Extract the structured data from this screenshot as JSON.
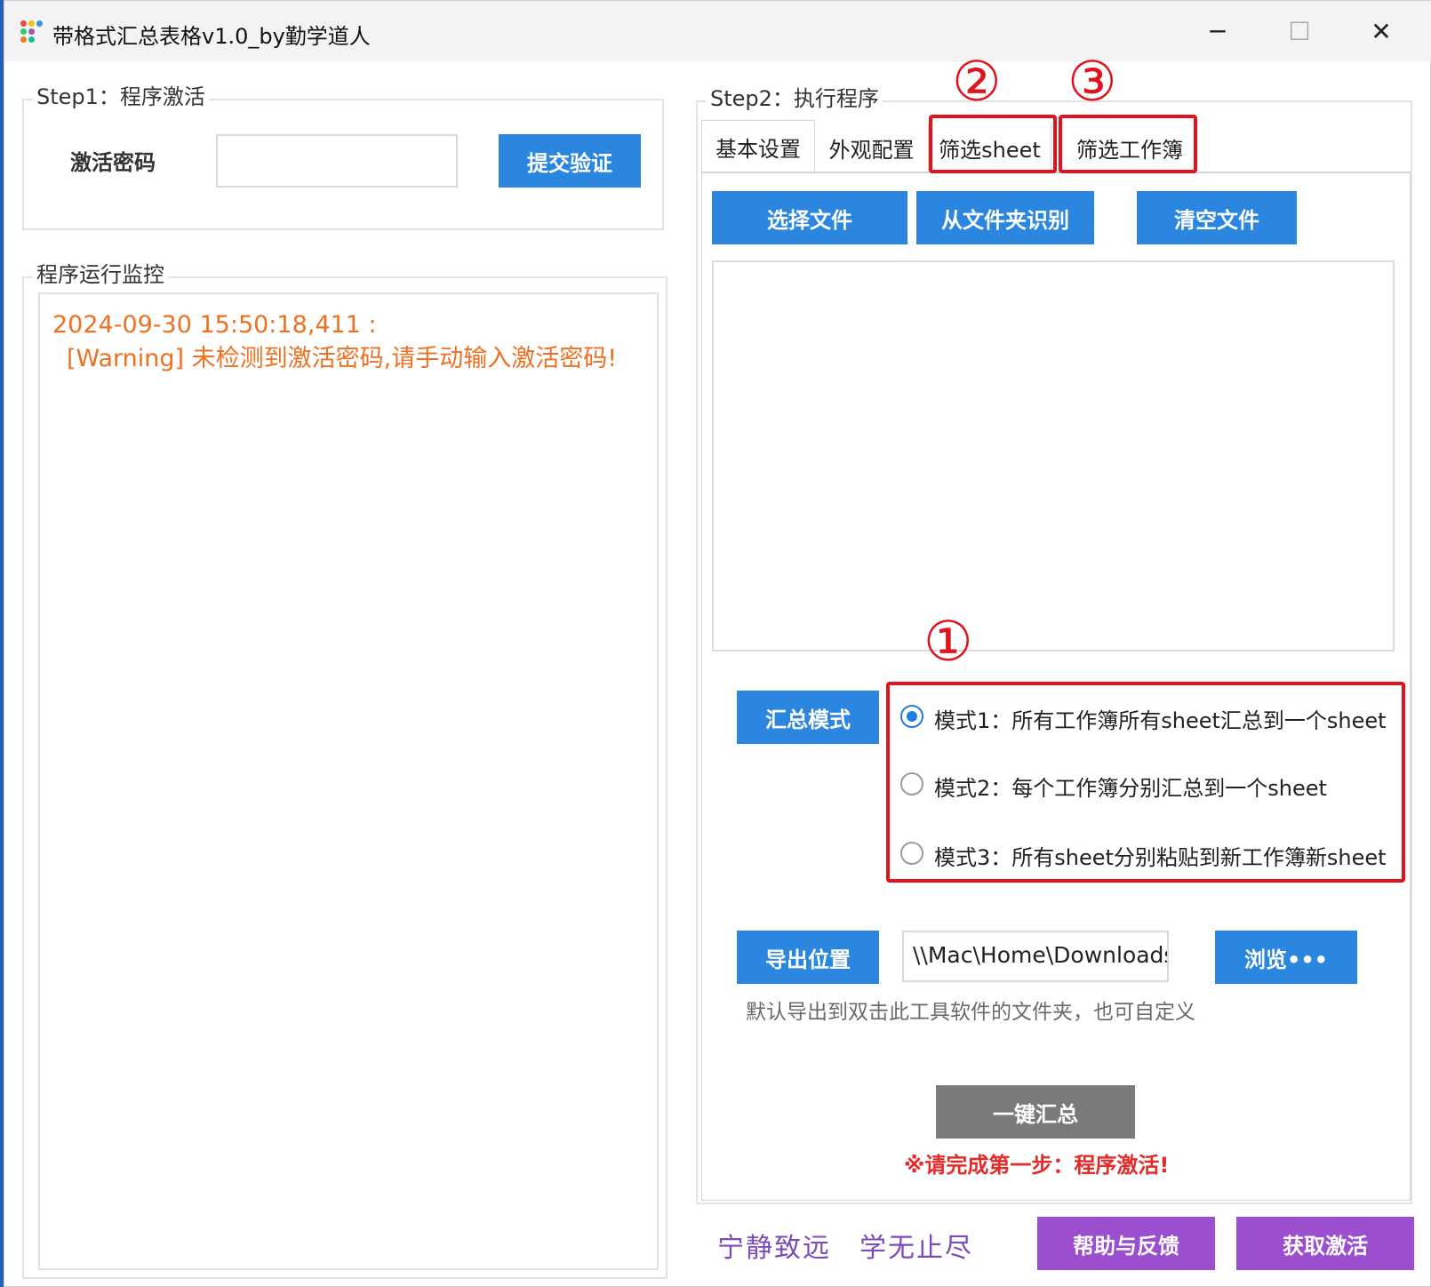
{
  "window": {
    "title": "带格式汇总表格v1.0_by勤学道人",
    "controls": {
      "minimize": "─",
      "maximize": "☐",
      "close": "✕"
    }
  },
  "step1": {
    "group_label": "Step1：程序激活",
    "password_label": "激活密码",
    "password_value": "",
    "submit_button": "提交验证"
  },
  "monitor": {
    "group_label": "程序运行监控",
    "log_lines": [
      "2024-09-30 15:50:18,411 :",
      "[Warning] 未检测到激活密码,请手动输入激活密码!"
    ]
  },
  "step2": {
    "group_label": "Step2：执行程序",
    "tabs": [
      {
        "label": "基本设置",
        "active": true
      },
      {
        "label": "外观配置",
        "active": false
      },
      {
        "label": "筛选sheet",
        "active": false
      },
      {
        "label": "筛选工作簿",
        "active": false
      }
    ],
    "buttons": {
      "select_file": "选择文件",
      "from_folder": "从文件夹识别",
      "clear_files": "清空文件"
    },
    "mode_button": "汇总模式",
    "modes": [
      {
        "label": "模式1：所有工作簿所有sheet汇总到一个sheet",
        "selected": true
      },
      {
        "label": "模式2：每个工作簿分别汇总到一个sheet",
        "selected": false
      },
      {
        "label": "模式3：所有sheet分别粘贴到新工作簿新sheet",
        "selected": false
      }
    ],
    "export_button": "导出位置",
    "export_path": "\\\\Mac\\Home\\Downloads",
    "browse_button": "浏览•••",
    "export_hint": "默认导出到双击此工具软件的文件夹，也可自定义",
    "run_button": "一键汇总",
    "run_warning": "※请完成第一步：程序激活!"
  },
  "annotations": {
    "mark_1": "①",
    "mark_2": "②",
    "mark_3": "③",
    "color": "#e0141e"
  },
  "footer": {
    "slogan_1": "宁静致远",
    "slogan_2": "学无止尽",
    "help_button": "帮助与反馈",
    "activate_button": "获取激活"
  },
  "colors": {
    "primary_blue": "#2b86e0",
    "purple": "#9b4fcf",
    "log_orange": "#f07022",
    "disabled_gray": "#7a7a7a"
  }
}
